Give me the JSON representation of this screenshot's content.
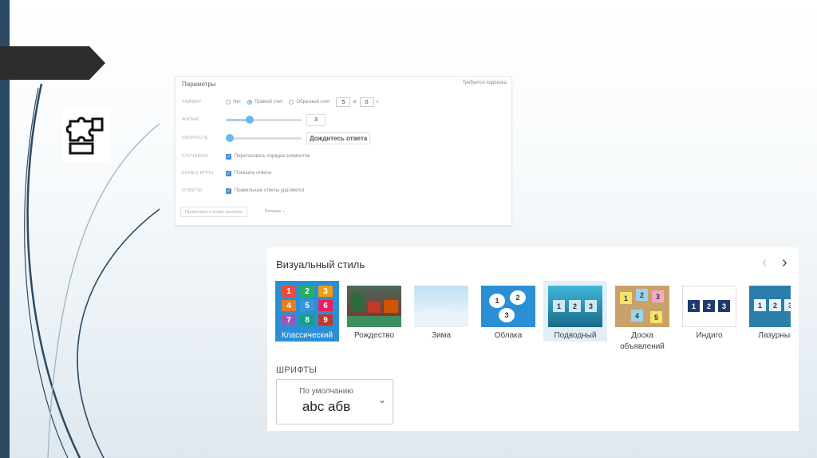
{
  "params": {
    "title": "Параметры",
    "subscription": "Требуется подписка",
    "timer": {
      "label": "ТАЙМЕР",
      "options": [
        "Нет",
        "Прямой счет",
        "Обратный счет"
      ],
      "selected": 1,
      "minutes": "5",
      "seconds": "0",
      "min_unit": "м",
      "sec_unit": "с"
    },
    "lives": {
      "label": "ЖИЗНИ",
      "value": "3",
      "slider_fraction": 0.3
    },
    "speed": {
      "label": "СКОРОСТЬ",
      "value": "Дождитесь ответа",
      "slider_fraction": 0.05
    },
    "random": {
      "label": "СЛУЧАЙНО",
      "option": "Перетасовать порядок элементов",
      "checked": true
    },
    "game_end": {
      "label": "КОНЕЦ ИГРЫ",
      "option": "Показать ответы",
      "checked": true
    },
    "answers": {
      "label": "ОТВЕТЫ",
      "option": "Правильные ответы удаляются",
      "checked": true
    },
    "apply_button": "Применить к этому занятию",
    "more_button": "Больше"
  },
  "visual_style": {
    "title": "Визуальный стиль",
    "prev_icon": "‹",
    "next_icon": "›",
    "themes": [
      {
        "label": "Классический",
        "selected": true
      },
      {
        "label": "Рождество"
      },
      {
        "label": "Зима"
      },
      {
        "label": "Облака"
      },
      {
        "label": "Подводный",
        "hover": true
      },
      {
        "label": "Доска объявлений"
      },
      {
        "label": "Индиго"
      },
      {
        "label": "Лазурный"
      }
    ],
    "thumb_numbers": [
      "1",
      "2",
      "3"
    ],
    "classic_numbers": [
      "1",
      "2",
      "3",
      "4",
      "5",
      "6",
      "7",
      "8",
      "9"
    ],
    "board_numbers": [
      "1",
      "2",
      "3",
      "4",
      "5"
    ]
  },
  "fonts": {
    "label": "ШРИФТЫ",
    "selected_name": "По умолчанию",
    "sample": "abc абв",
    "chevron": "⌄"
  },
  "colors": {
    "accent": "#2b8fd6",
    "sidebar": "#2c4a63",
    "arrow": "#2d2d2d"
  }
}
